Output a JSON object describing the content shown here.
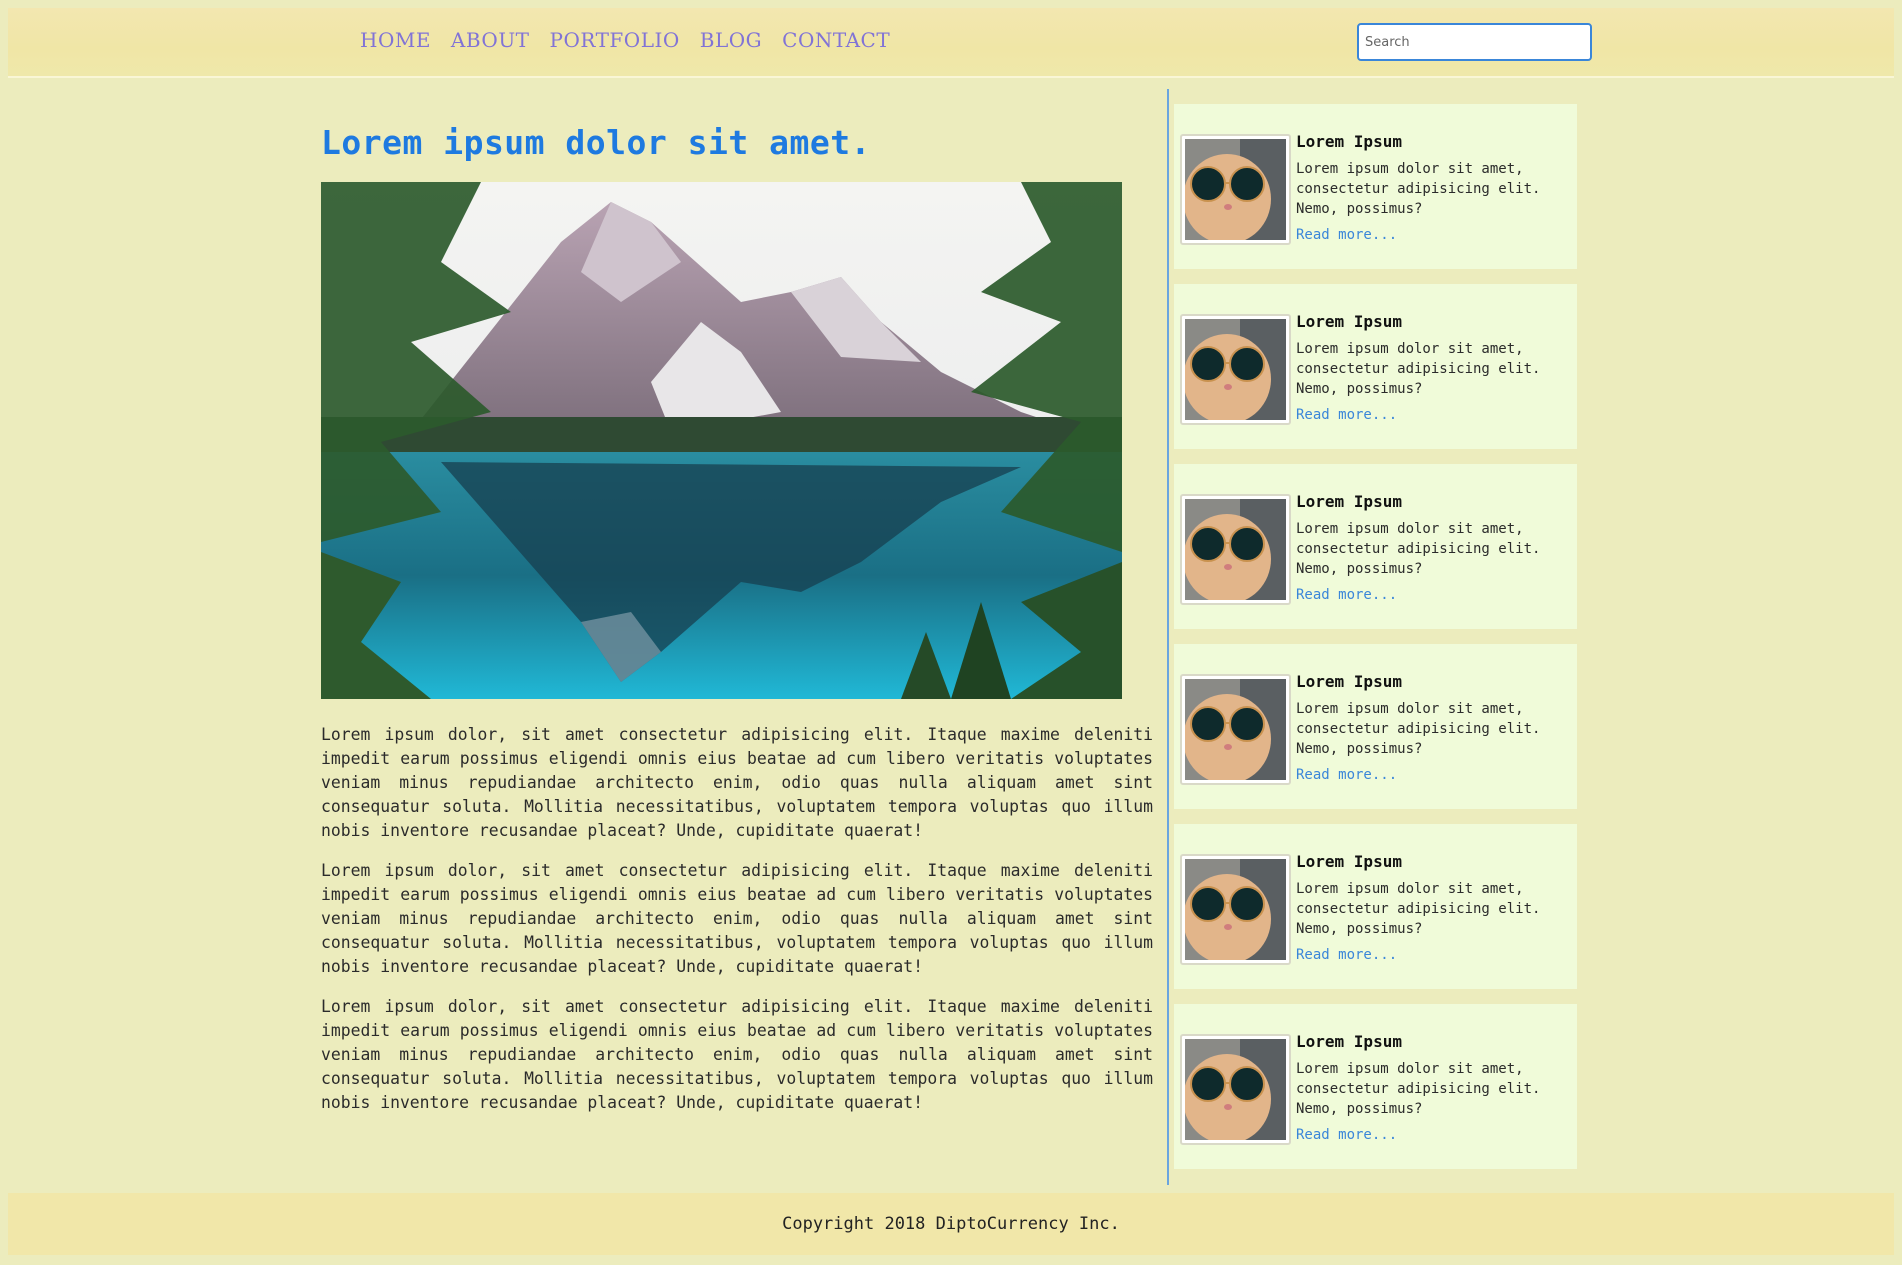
{
  "nav": {
    "items": [
      "HOME",
      "ABOUT",
      "PORTFOLIO",
      "BLOG",
      "CONTACT"
    ]
  },
  "search": {
    "placeholder": "Search"
  },
  "article": {
    "title": "Lorem ipsum dolor sit amet.",
    "paragraphs": [
      "Lorem ipsum dolor, sit amet consectetur adipisicing elit. Itaque maxime deleniti impedit earum possimus eligendi omnis eius beatae ad cum libero veritatis voluptates veniam minus repudiandae architecto enim, odio quas nulla aliquam amet sint consequatur soluta. Mollitia necessitatibus, voluptatem tempora voluptas quo illum nobis inventore recusandae placeat? Unde, cupiditate quaerat!",
      "Lorem ipsum dolor, sit amet consectetur adipisicing elit. Itaque maxime deleniti impedit earum possimus eligendi omnis eius beatae ad cum libero veritatis voluptates veniam minus repudiandae architecto enim, odio quas nulla aliquam amet sint consequatur soluta. Mollitia necessitatibus, voluptatem tempora voluptas quo illum nobis inventore recusandae placeat? Unde, cupiditate quaerat!",
      "Lorem ipsum dolor, sit amet consectetur adipisicing elit. Itaque maxime deleniti impedit earum possimus eligendi omnis eius beatae ad cum libero veritatis voluptates veniam minus repudiandae architecto enim, odio quas nulla aliquam amet sint consequatur soluta. Mollitia necessitatibus, voluptatem tempora voluptas quo illum nobis inventore recusandae placeat? Unde, cupiditate quaerat!"
    ]
  },
  "sidebar": {
    "cards": [
      {
        "title": "Lorem Ipsum",
        "text": "Lorem ipsum dolor sit amet, consectetur adipisicing elit. Nemo, possimus?",
        "link": "Read more..."
      },
      {
        "title": "Lorem Ipsum",
        "text": "Lorem ipsum dolor sit amet, consectetur adipisicing elit. Nemo, possimus?",
        "link": "Read more..."
      },
      {
        "title": "Lorem Ipsum",
        "text": "Lorem ipsum dolor sit amet, consectetur adipisicing elit. Nemo, possimus?",
        "link": "Read more..."
      },
      {
        "title": "Lorem Ipsum",
        "text": "Lorem ipsum dolor sit amet, consectetur adipisicing elit. Nemo, possimus?",
        "link": "Read more..."
      },
      {
        "title": "Lorem Ipsum",
        "text": "Lorem ipsum dolor sit amet, consectetur adipisicing elit. Nemo, possimus?",
        "link": "Read more..."
      },
      {
        "title": "Lorem Ipsum",
        "text": "Lorem ipsum dolor sit amet, consectetur adipisicing elit. Nemo, possimus?",
        "link": "Read more..."
      }
    ]
  },
  "footer": {
    "text": "Copyright 2018 DiptoCurrency Inc."
  },
  "colors": {
    "background": "#ececbd",
    "header": "#f0e6a6",
    "nav_link": "#8173d6",
    "title": "#1e7ae0",
    "link": "#3a86d9",
    "card": "#f0fbd9"
  }
}
